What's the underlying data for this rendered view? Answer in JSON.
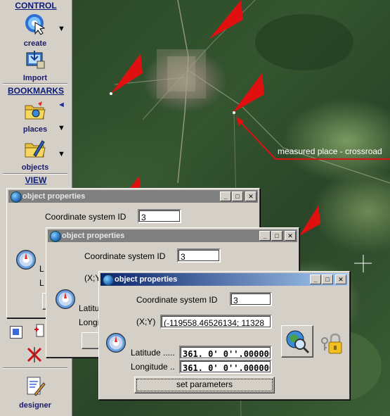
{
  "toolbar": {
    "control_label": "CONTROL",
    "create_label": "create",
    "import_label": "Import",
    "bookmarks_label": "BOOKMARKS",
    "places_label": "places",
    "objects_label": "objects",
    "view_label": "VIEW",
    "designer_label": "designer",
    "arrow_glyph": "▼",
    "back_glyph": "◄"
  },
  "map": {
    "annotation": "measured place - crossroad",
    "annotation_color": "#e01010",
    "marker_color": "#e01010"
  },
  "dialogs": [
    {
      "title": "object properties",
      "coord_label": "Coordinate system ID",
      "coord_value": "3",
      "partial_labels": [
        "L",
        "L"
      ]
    },
    {
      "title": "object properties",
      "coord_label": "Coordinate system ID",
      "coord_value": "3",
      "xy_label": "(X;Y",
      "lat_label": "Latitu",
      "long_label": "Longi"
    },
    {
      "title": "object properties",
      "coord_label": "Coordinate system ID",
      "coord_value": "3",
      "xy_label": "(X;Y)",
      "xy_value": "(-119558.46526134; 11328",
      "lat_label": "Latitude .....",
      "lat_value": "361. 0' 0''.0000000",
      "long_label": "Longitude ..",
      "long_value": "361. 0' 0''.0000000",
      "set_button": "set parameters"
    }
  ],
  "window_buttons": {
    "minimize": "_",
    "maximize": "□",
    "close": "✕"
  },
  "colors": {
    "titlebar_active": "#0a246a",
    "titlebar_inactive": "#808080",
    "panel": "#d4d0c8"
  }
}
